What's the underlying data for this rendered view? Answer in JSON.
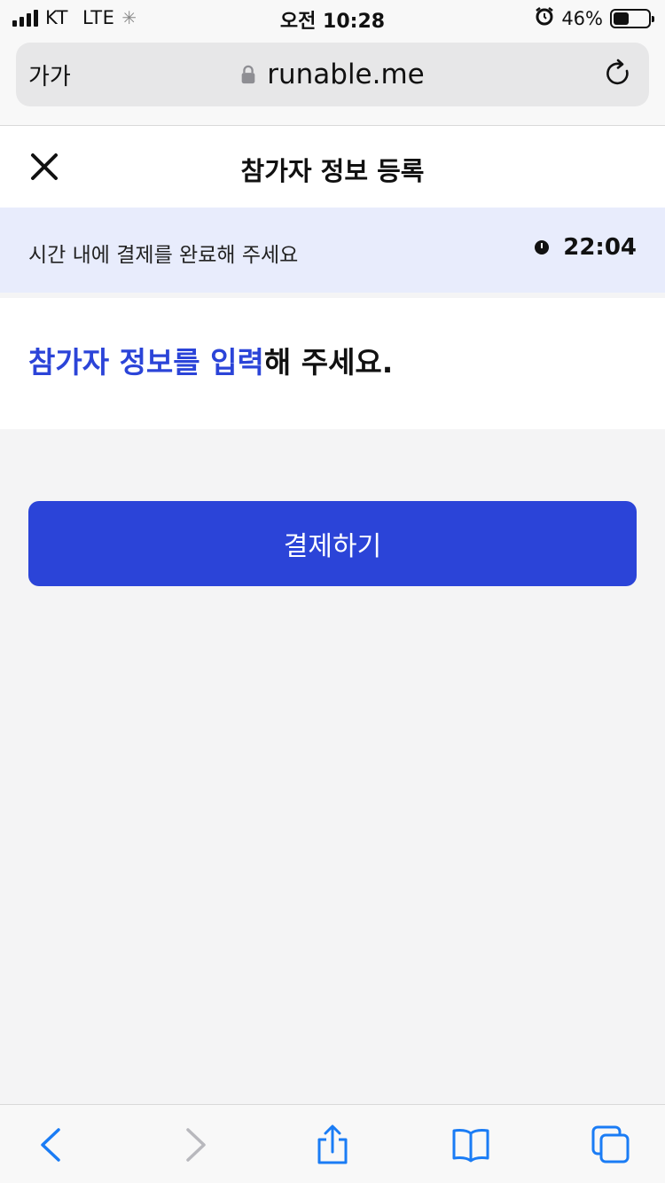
{
  "status_bar": {
    "carrier": "KT",
    "network": "LTE",
    "time": "오전 10:28",
    "battery_percent": "46%",
    "battery_level": 0.46
  },
  "browser": {
    "text_size_label": "가가",
    "url": "runable.me"
  },
  "header": {
    "title": "참가자 정보 등록"
  },
  "banner": {
    "message": "시간 내에 결제를 완료해 주세요",
    "timer": "22:04"
  },
  "main": {
    "heading_accent": "참가자 정보를 입력",
    "heading_rest": "해 주세요."
  },
  "pay_button": {
    "label": "결제하기"
  },
  "colors": {
    "accent": "#2b44d8",
    "banner_bg": "#e8ecfc",
    "ios_blue": "#1a7cf5"
  }
}
